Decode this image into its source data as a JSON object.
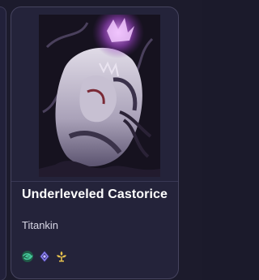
{
  "card": {
    "title": "Underleveled Castorice",
    "subtitle": "Titankin",
    "trait_icons": [
      "wind-element-icon",
      "quantum-path-icon",
      "harmony-path-icon"
    ]
  },
  "colors": {
    "card_background": "#24233a",
    "card_border": "#46445f",
    "title_text": "#ffffff",
    "subtitle_text": "#d8d7e6",
    "wind_icon": "#45c79a",
    "quantum_icon": "#8f86f2",
    "harmony_icon": "#e6c14d"
  }
}
